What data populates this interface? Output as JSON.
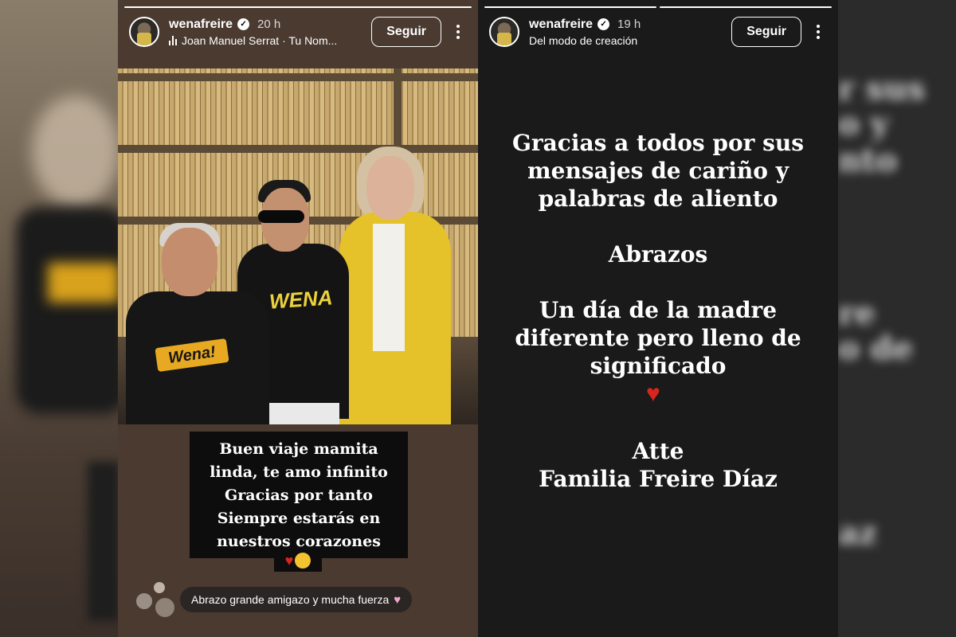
{
  "left_story": {
    "username": "wenafreire",
    "time": "20 h",
    "music": "Joan Manuel Serrat · Tu Nom...",
    "follow_label": "Seguir",
    "shirt_text_mid": "WENA",
    "shirt_text_left": "Wena!",
    "caption_lines": [
      "Buen viaje mamita",
      "linda, te amo infinito",
      "Gracias por tanto",
      "Siempre estarás en",
      "nuestros corazones"
    ],
    "comment": "Abrazo grande amigazo y mucha fuerza"
  },
  "right_story": {
    "username": "wenafreire",
    "time": "19 h",
    "subtitle": "Del modo de creación",
    "follow_label": "Seguir",
    "lines": [
      "Gracias a todos por sus",
      "mensajes de cariño y",
      "palabras de aliento",
      "Abrazos",
      "Un día de la madre",
      "diferente pero lleno de",
      "significado",
      "Atte",
      "Familia Freire Díaz"
    ]
  },
  "side_ghost_text": [
    "r sus",
    "o y",
    "nto",
    "re",
    "o de",
    "az"
  ],
  "colors": {
    "accent_yellow": "#e5c22a",
    "heart_red": "#d9261c",
    "story_dark": "#1a1a1a",
    "story_brown": "#4a3a30"
  },
  "icons": [
    "verified-icon",
    "music-icon",
    "more-icon",
    "heart-icon",
    "smiley-icon"
  ]
}
